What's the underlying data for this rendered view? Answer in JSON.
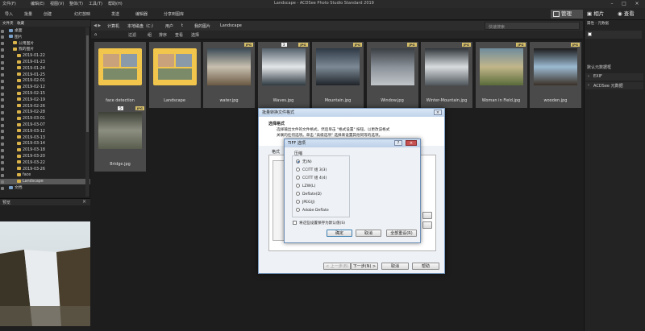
{
  "app": {
    "title": "Landscape - ACDSee Photo Studio Standard 2019"
  },
  "menu": [
    "文件(F)",
    "编辑(E)",
    "视图(V)",
    "整体(T)",
    "工具(T)",
    "帮助(H)"
  ],
  "toolbar": {
    "import": "导入",
    "batch": "批量",
    "create": "创建",
    "slideshow": "幻灯放映",
    "send": "发送",
    "editor": "编辑器",
    "share": "分享到图库",
    "manage": "管理",
    "photos": "相片",
    "view": "查看"
  },
  "left": {
    "tabs": [
      "文件夹",
      "收藏"
    ],
    "tree": [
      {
        "label": "桌面",
        "level": 1
      },
      {
        "label": "图片",
        "level": 1
      },
      {
        "label": "公用图片",
        "level": 2
      },
      {
        "label": "我的图片",
        "level": 2
      },
      {
        "label": "2019-01-22",
        "level": 3
      },
      {
        "label": "2019-01-23",
        "level": 3
      },
      {
        "label": "2019-01-24",
        "level": 3
      },
      {
        "label": "2019-01-25",
        "level": 3
      },
      {
        "label": "2019-02-01",
        "level": 3
      },
      {
        "label": "2019-02-12",
        "level": 3
      },
      {
        "label": "2019-02-15",
        "level": 3
      },
      {
        "label": "2019-02-19",
        "level": 3
      },
      {
        "label": "2019-02-26",
        "level": 3
      },
      {
        "label": "2019-02-28",
        "level": 3
      },
      {
        "label": "2019-03-01",
        "level": 3
      },
      {
        "label": "2019-03-07",
        "level": 3
      },
      {
        "label": "2019-03-12",
        "level": 3
      },
      {
        "label": "2019-03-13",
        "level": 3
      },
      {
        "label": "2019-03-14",
        "level": 3
      },
      {
        "label": "2019-03-18",
        "level": 3
      },
      {
        "label": "2019-03-20",
        "level": 3
      },
      {
        "label": "2019-03-22",
        "level": 3
      },
      {
        "label": "2019-03-26",
        "level": 3
      },
      {
        "label": "face",
        "level": 3
      },
      {
        "label": "Landscape",
        "level": 3,
        "selected": true
      },
      {
        "label": "文档",
        "level": 1
      }
    ],
    "preview_title": "预览"
  },
  "pathbar": {
    "crumbs": [
      "计算机",
      "本地磁盘（C:）",
      "用户",
      "t",
      "我的图片",
      "Landscape"
    ],
    "search_placeholder": "快速搜索"
  },
  "filterbar": [
    "过滤",
    "组",
    "排序",
    "查看",
    "选择"
  ],
  "grid": {
    "tiles": [
      {
        "label": "face detection",
        "kind": "folder"
      },
      {
        "label": "Landscape",
        "kind": "folder"
      },
      {
        "label": "water.jpg",
        "kind": "photo",
        "badge": "JPG"
      },
      {
        "label": "Waves.jpg",
        "kind": "photo",
        "badge": "JPG",
        "num": "3"
      },
      {
        "label": "Mountain.jpg",
        "kind": "photo",
        "badge": "JPG"
      },
      {
        "label": "Window.jpg",
        "kind": "photo",
        "badge": "JPG"
      },
      {
        "label": "Winter-Mountain.jpg",
        "kind": "photo",
        "badge": "JPG"
      },
      {
        "label": "Woman in Field.jpg",
        "kind": "photo",
        "badge": "JPG"
      },
      {
        "label": "wooden.jpg",
        "kind": "photo",
        "badge": "JPG"
      },
      {
        "label": "Bridge.jpg",
        "kind": "photo",
        "badge": "JPG",
        "num": "5"
      }
    ]
  },
  "right": {
    "tabs": [
      "属性 - 元数据"
    ],
    "items": [
      "默认元数据框",
      "EXIF",
      "ACDSee 元数据"
    ]
  },
  "dialog_batch": {
    "title": "批量转换文件格式",
    "heading": "选择格式",
    "desc1": "选择输出文件的文件格式，然后单击 \"格式设置\" 按钮，以更改该格式",
    "desc2": "关联的任何选项。单击 \"高级选项\" 选择来设置其他同等的选项。",
    "tab_format": "格式",
    "back": "< 上一步(B)",
    "next": "下一步(N) >",
    "cancel": "取消",
    "help": "帮助"
  },
  "dialog_tiff": {
    "title": "TIFF 选项",
    "group": "压缩",
    "options": [
      "无(N)",
      "CCITT 组 3(3)",
      "CCITT 组 4(4)",
      "LZW(L)",
      "Deflate(D)",
      "JPEG(J)",
      "Adobe Deflate"
    ],
    "selected_index": 0,
    "save_default": "将这些设置保存为默认值(S)",
    "ok": "确定",
    "cancel": "取消",
    "reset": "全部重设(R)"
  }
}
